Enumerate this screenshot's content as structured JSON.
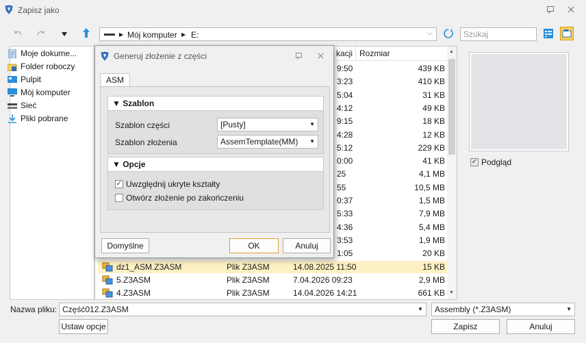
{
  "window": {
    "title": "Zapisz jako"
  },
  "toolbar": {
    "path_root": "Mój komputer",
    "path_drive": "E:",
    "search_placeholder": "Szukaj"
  },
  "sidebar": {
    "items": [
      {
        "label": "Moje dokume...",
        "icon": "documents-icon"
      },
      {
        "label": "Folder roboczy",
        "icon": "folder-icon"
      },
      {
        "label": "Pulpit",
        "icon": "desktop-icon"
      },
      {
        "label": "Mój komputer",
        "icon": "computer-icon"
      },
      {
        "label": "Sieć",
        "icon": "network-icon"
      },
      {
        "label": "Pliki pobrane",
        "icon": "download-icon"
      }
    ]
  },
  "file_list": {
    "columns": {
      "modified_partial": "kacji",
      "size": "Rozmiar"
    },
    "partial_rows": [
      {
        "time": "9:50",
        "size": "439 KB"
      },
      {
        "time": "3:23",
        "size": "410 KB"
      },
      {
        "time": "5:04",
        "size": "31 KB"
      },
      {
        "time": "4:12",
        "size": "49 KB"
      },
      {
        "time": "9:15",
        "size": "18 KB"
      },
      {
        "time": "4:28",
        "size": "12 KB"
      },
      {
        "time": "5:12",
        "size": "229 KB"
      },
      {
        "time": "0:00",
        "size": "41 KB"
      },
      {
        "time": "25",
        "size": "4,1 MB"
      },
      {
        "time": "55",
        "size": "10,5 MB"
      },
      {
        "time": "0:37",
        "size": "1,5 MB"
      },
      {
        "time": "5:33",
        "size": "7,9 MB"
      },
      {
        "time": "4:36",
        "size": "5,4 MB"
      },
      {
        "time": "3:53",
        "size": "1,9 MB"
      },
      {
        "time": "1:05",
        "size": "20 KB"
      }
    ],
    "rows": [
      {
        "name": "dz1_ASM.Z3ASM",
        "type": "Plik Z3ASM",
        "date": "14.08.2025 11:50",
        "size": "15 KB"
      },
      {
        "name": "5.Z3ASM",
        "type": "Plik Z3ASM",
        "date": "7.04.2026 09:23",
        "size": "2,9 MB"
      },
      {
        "name": "4.Z3ASM",
        "type": "Plik Z3ASM",
        "date": "14.04.2026 14:21",
        "size": "661 KB"
      }
    ]
  },
  "preview": {
    "checkbox_label": "Podgląd",
    "checked": true
  },
  "bottom": {
    "filename_label": "Nazwa pliku:",
    "filename_value": "Część012.Z3ASM",
    "filetype_value": "Assembly (*.Z3ASM)",
    "options_button": "Ustaw opcje",
    "save_button": "Zapisz",
    "cancel_button": "Anuluj"
  },
  "dialog": {
    "title": "Generuj złożenie z części",
    "tab": "ASM",
    "section_template": "Szablon",
    "part_template_label": "Szablon części",
    "part_template_value": "[Pusty]",
    "assembly_template_label": "Szablon złożenia",
    "assembly_template_value": "AssemTemplate(MM)",
    "section_options": "Opcje",
    "include_hidden_label": "Uwzględnij ukryte kształty",
    "include_hidden_checked": true,
    "open_after_label": "Otwórz złożenie po zakończeniu",
    "open_after_checked": false,
    "defaults_button": "Domyślne",
    "ok_button": "OK",
    "cancel_button": "Anuluj"
  },
  "colors": {
    "selected_row": "#fdf1c4",
    "accent_blue": "#1f8ad8",
    "ok_border": "#e0a030"
  }
}
